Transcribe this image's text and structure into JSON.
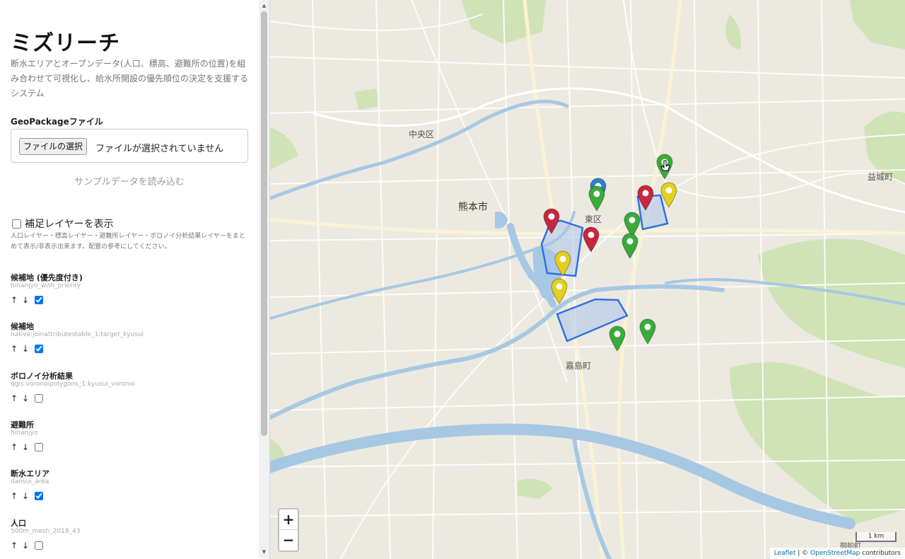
{
  "sidebar": {
    "title": "ミズリーチ",
    "description": "断水エリアとオープンデータ(人口、標高、避難所の位置)を組み合わせて可視化し、給水所開設の優先順位の決定を支援するシステム",
    "file_section_label": "GeoPackageファイル",
    "file_button_label": "ファイルの選択",
    "file_status": "ファイルが選択されていません",
    "sample_link": "サンプルデータを読み込む",
    "aux_layers_label": "補足レイヤーを表示",
    "aux_layers_checked": false,
    "aux_layers_note": "人口レイヤー・標高レイヤー・避難所レイヤー・ボロノイ分析結果レイヤーをまとめて表示/非表示出来ます。配置の参考にしてください。",
    "up_arrow": "↑",
    "down_arrow": "↓",
    "layers": [
      {
        "name": "候補地 (優先度付き)",
        "id": "hinanjyo_with_priority",
        "checked": true
      },
      {
        "name": "候補地",
        "id": "native:joinattributestable_1:target_kyusui",
        "checked": true
      },
      {
        "name": "ボロノイ分析結果",
        "id": "qgis:voronoipolygons_1:kyusui_voronoi",
        "checked": false
      },
      {
        "name": "避難所",
        "id": "hinanjyo",
        "checked": false
      },
      {
        "name": "断水エリア",
        "id": "dansui_area",
        "checked": true
      },
      {
        "name": "人口",
        "id": "500m_mesh_2018_43",
        "checked": false
      }
    ]
  },
  "map": {
    "labels": {
      "chuo": "中央区",
      "kumamoto": "熊本市",
      "higashi": "東区",
      "kashima": "嘉島町",
      "mashiki": "益城町",
      "misato": "御船町"
    },
    "zoom_in": "+",
    "zoom_out": "−",
    "scale": "1 km",
    "attribution_leaflet": "Leaflet",
    "attribution_sep": " | © ",
    "attribution_osm": "OpenStreetMap",
    "attribution_tail": " contributors",
    "marker_colors": {
      "green": "#3aab3a",
      "red": "#c8263e",
      "yellow": "#e5cf1d",
      "blue": "#2b82cb"
    },
    "polygon_stroke": "#3170e0",
    "polygon_fill": "#a9c4ec"
  }
}
